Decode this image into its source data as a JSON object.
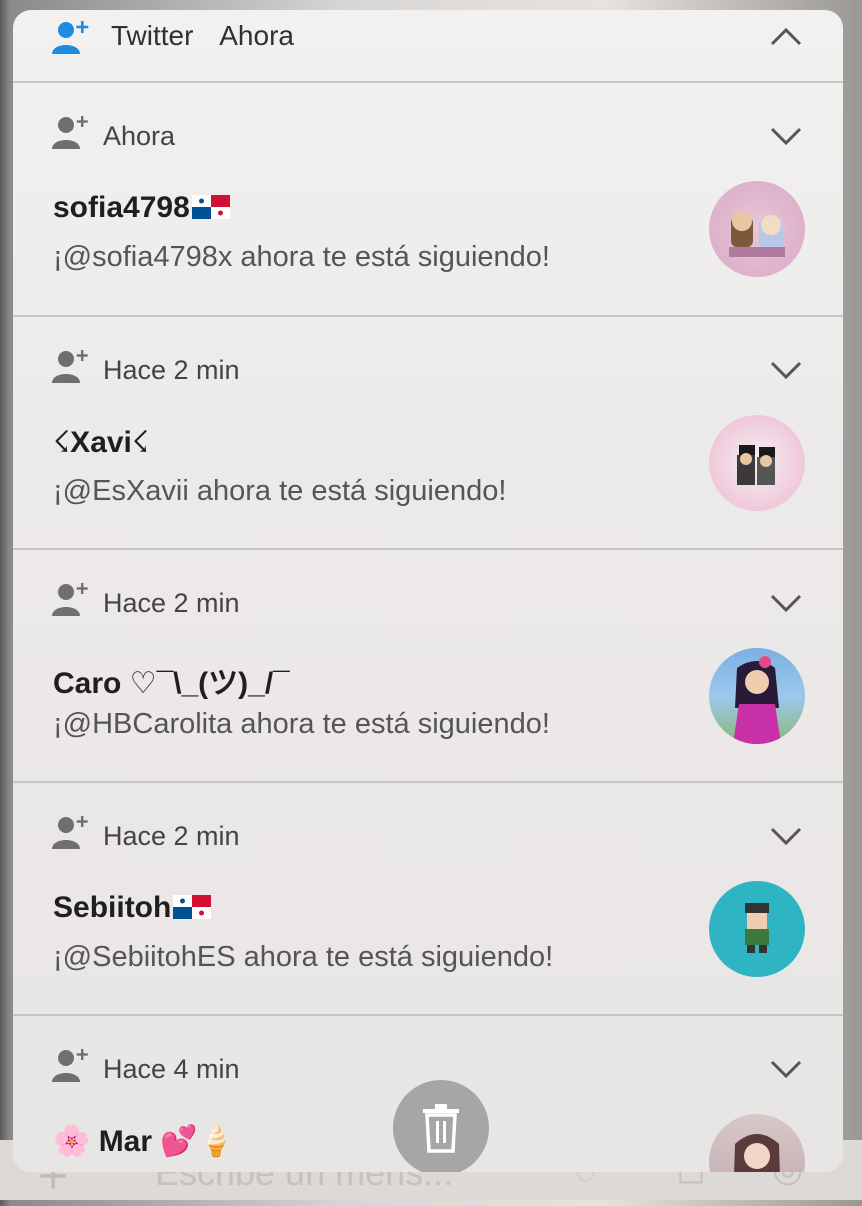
{
  "group": {
    "app_name": "Twitter",
    "time": "Ahora"
  },
  "notifications": [
    {
      "time": "Ahora",
      "name": "sofia4798",
      "message": "¡@sofia4798x ahora te está siguiendo!",
      "flag": "panama"
    },
    {
      "time": "Hace 2 min",
      "name": "☇Xavi☇",
      "message": "¡@EsXavii ahora te está siguiendo!"
    },
    {
      "time": "Hace 2 min",
      "name": "Caro ♡¯\\_(ツ)_/¯",
      "message": "¡@HBCarolita ahora te está siguiendo!"
    },
    {
      "time": "Hace 2 min",
      "name": "Sebiitoh",
      "message": "¡@SebiitohES ahora te está siguiendo!",
      "flag": "panama"
    },
    {
      "time": "Hace 4 min",
      "name": "🌸 Mar 💕🍦",
      "message": ""
    }
  ],
  "compose": {
    "placeholder": "Escribe un mens..."
  },
  "icons": {
    "group_header": "person-add-icon",
    "item": "person-add-icon",
    "collapse": "chevron-up-icon",
    "expand": "chevron-down-icon",
    "delete": "trash-icon"
  },
  "colors": {
    "twitter_blue": "#1d8ce0",
    "icon_gray": "#6f6f6f"
  }
}
